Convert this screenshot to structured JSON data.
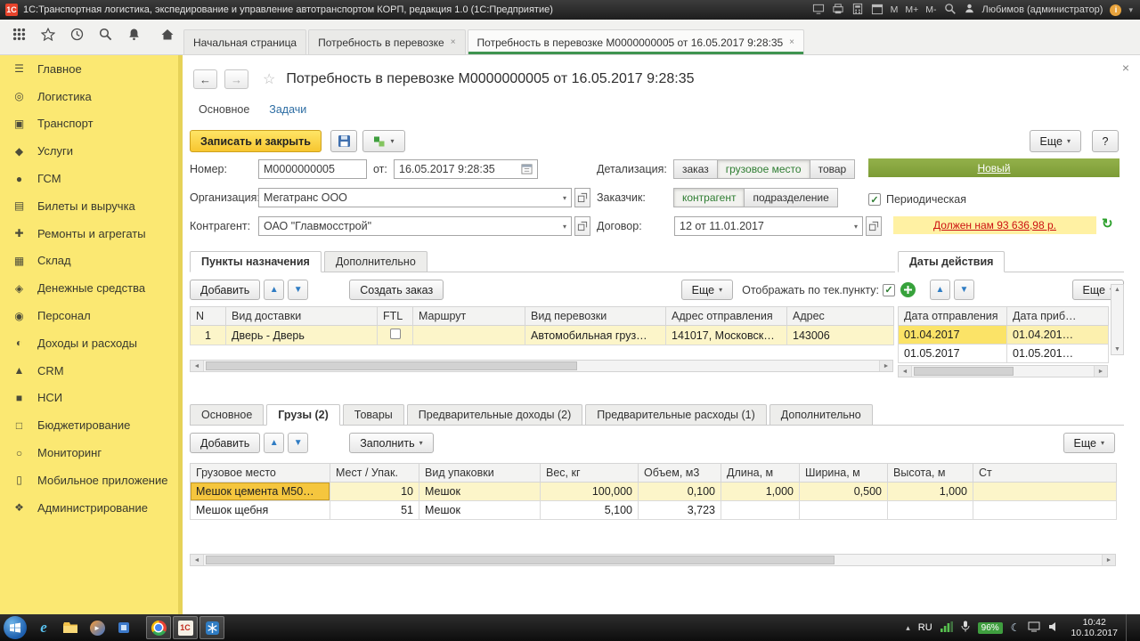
{
  "icons": {
    "close": "×",
    "back": "←",
    "forward": "→",
    "star": "☆",
    "caret": "▾",
    "up": "▲",
    "down": "▼",
    "left": "◄",
    "right": "►",
    "check": "✓",
    "refresh": "↻",
    "tray_up": "▴",
    "moon": "☾",
    "play": "►"
  },
  "titlebar": {
    "logo": "1С",
    "title": "1С:Транспортная логистика, экспедирование и управление автотранспортом КОРП, редакция 1.0  (1С:Предприятие)",
    "memory": [
      "М",
      "М+",
      "М-"
    ],
    "user": "Любимов (администратор)",
    "info": "i"
  },
  "tabs": [
    "Начальная страница",
    "Потребность в перевозке",
    "Потребность в перевозке М0000000005 от 16.05.2017 9:28:35"
  ],
  "sidebar": [
    {
      "icon": "☰",
      "label": "Главное"
    },
    {
      "icon": "◎",
      "label": "Логистика"
    },
    {
      "icon": "▣",
      "label": "Транспорт"
    },
    {
      "icon": "◆",
      "label": "Услуги"
    },
    {
      "icon": "●",
      "label": "ГСМ"
    },
    {
      "icon": "▤",
      "label": "Билеты и выручка"
    },
    {
      "icon": "✚",
      "label": "Ремонты и агрегаты"
    },
    {
      "icon": "▦",
      "label": "Склад"
    },
    {
      "icon": "◈",
      "label": "Денежные средства"
    },
    {
      "icon": "◉",
      "label": "Персонал"
    },
    {
      "icon": "◐",
      "label": "Доходы и расходы"
    },
    {
      "icon": "▲",
      "label": "CRM"
    },
    {
      "icon": "■",
      "label": "НСИ"
    },
    {
      "icon": "□",
      "label": "Бюджетирование"
    },
    {
      "icon": "○",
      "label": "Мониторинг"
    },
    {
      "icon": "▯",
      "label": "Мобильное приложение"
    },
    {
      "icon": "❖",
      "label": "Администрирование"
    }
  ],
  "doc": {
    "title": "Потребность в перевозке М0000000005 от 16.05.2017 9:28:35",
    "view_tabs": [
      "Основное",
      "Задачи"
    ],
    "cmd": {
      "save_close": "Записать и закрыть",
      "more": "Еще",
      "help": "?"
    },
    "form": {
      "number_label": "Номер:",
      "number": "М0000000005",
      "from_label": "от:",
      "date": "16.05.2017  9:28:35",
      "detail_label": "Детализация:",
      "detail": [
        "заказ",
        "грузовое место",
        "товар"
      ],
      "new_link": "Новый",
      "org_label": "Организация:",
      "org": "Мегатранс ООО",
      "customer_label": "Заказчик:",
      "customer": [
        "контрагент",
        "подразделение"
      ],
      "periodic": "Периодическая",
      "contractor_label": "Контрагент:",
      "contractor": "ОАО \"Главмосстрой\"",
      "contract_label": "Договор:",
      "contract": "12  от 11.01.2017",
      "debt": "Должен нам 93 636,98 р."
    },
    "dest": {
      "tabs": [
        "Пункты назначения",
        "Дополнительно"
      ],
      "add": "Добавить",
      "create_order": "Создать заказ",
      "more": "Еще",
      "show_current": "Отображать по тек.пункту:",
      "cols": [
        "N",
        "Вид доставки",
        "FTL",
        "Маршрут",
        "Вид перевозки",
        "Адрес отправления",
        "Адрес"
      ],
      "row": {
        "n": "1",
        "delivery": "Дверь - Дверь",
        "transport": "Автомобильная груз…",
        "from": "141017, Московск…",
        "to": "143006"
      }
    },
    "dates": {
      "tab": "Даты действия",
      "more": "Еще",
      "cols": [
        "Дата отправления",
        "Дата приб…"
      ],
      "rows": [
        {
          "d": "01.04.2017",
          "a": "01.04.201…"
        },
        {
          "d": "01.05.2017",
          "a": "01.05.201…"
        }
      ]
    },
    "cargo": {
      "tabs": [
        "Основное",
        "Грузы (2)",
        "Товары",
        "Предварительные доходы (2)",
        "Предварительные расходы (1)",
        "Дополнительно"
      ],
      "add": "Добавить",
      "fill": "Заполнить",
      "more": "Еще",
      "cols": [
        "Грузовое место",
        "Мест / Упак.",
        "Вид упаковки",
        "Вес, кг",
        "Объем, м3",
        "Длина, м",
        "Ширина, м",
        "Высота, м",
        "Ст"
      ],
      "rows": [
        {
          "place": "Мешок цемента М50…",
          "qty": "10",
          "pack": "Мешок",
          "weight": "100,000",
          "vol": "0,100",
          "len": "1,000",
          "wid": "0,500",
          "hei": "1,000"
        },
        {
          "place": "Мешок щебня",
          "qty": "51",
          "pack": "Мешок",
          "weight": "5,100",
          "vol": "3,723",
          "len": "",
          "wid": "",
          "hei": ""
        }
      ]
    }
  },
  "taskbar": {
    "lang": "RU",
    "battery": "96%",
    "time": "10:42",
    "date": "10.10.2017"
  }
}
